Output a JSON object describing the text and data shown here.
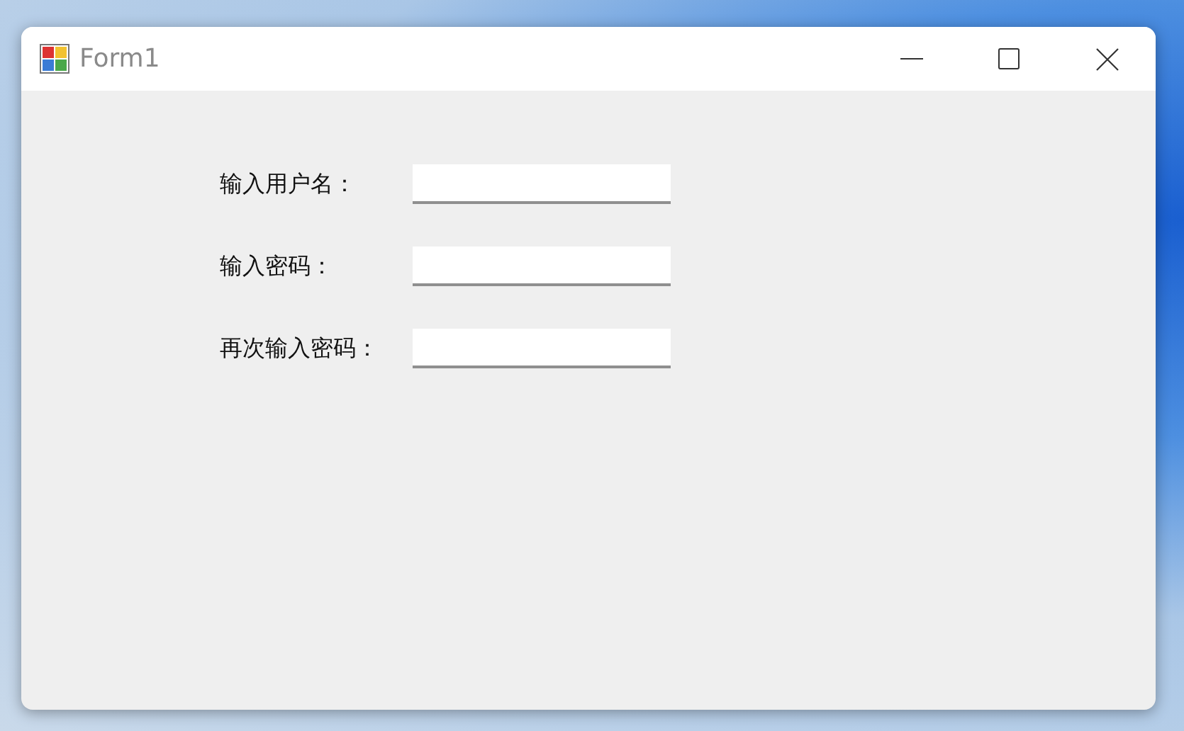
{
  "window": {
    "title": "Form1"
  },
  "fields": [
    {
      "label": "输入用户名："
    },
    {
      "label": "输入密码："
    },
    {
      "label": "再次输入密码："
    }
  ]
}
